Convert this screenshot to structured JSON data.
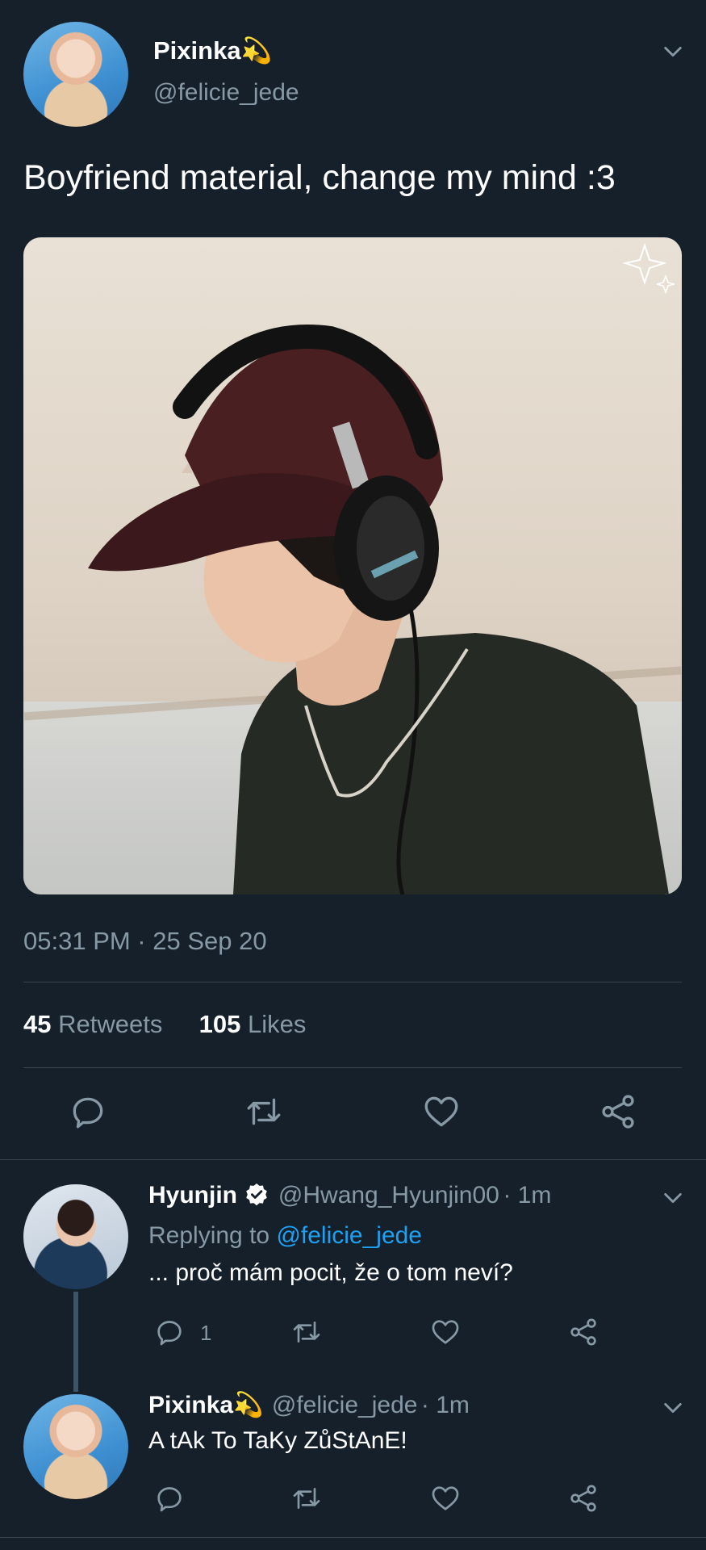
{
  "main_tweet": {
    "author_name": "Pixinka",
    "author_emoji": "💫",
    "author_handle": "@felicie_jede",
    "text": "Boyfriend material, change my mind :3",
    "timestamp": "05:31 PM · 25 Sep 20",
    "retweets_count": "45",
    "retweets_label": "Retweets",
    "likes_count": "105",
    "likes_label": "Likes"
  },
  "replies": [
    {
      "author_name": "Hyunjin",
      "author_handle": "@Hwang_Hyunjin00",
      "time": "· 1m",
      "replying_prefix": "Replying to",
      "replying_handle": "@felicie_jede",
      "text": "... proč mám pocit, že o tom neví?",
      "reply_count": "1"
    },
    {
      "author_name": "Pixinka",
      "author_emoji": "💫",
      "author_handle": "@felicie_jede",
      "time": "· 1m",
      "text": "A tAk To TaKy ZůStAnE!"
    }
  ],
  "colors": {
    "background": "#15202b",
    "secondary_text": "#8899a6",
    "link": "#1da1f2",
    "divider": "#38444d"
  },
  "icons": {
    "reply": "reply-icon",
    "retweet": "retweet-icon",
    "like": "heart-icon",
    "share": "share-icon",
    "menu": "chevron-down-icon",
    "verified": "verified-badge-icon"
  }
}
